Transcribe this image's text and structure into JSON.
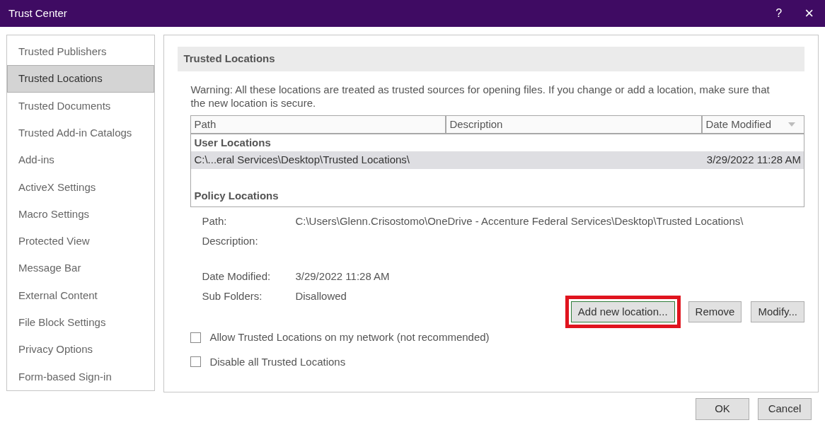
{
  "window": {
    "title": "Trust Center",
    "help": "?",
    "close": "×"
  },
  "sidebar": {
    "items": [
      {
        "label": "Trusted Publishers",
        "selected": false
      },
      {
        "label": "Trusted Locations",
        "selected": true
      },
      {
        "label": "Trusted Documents",
        "selected": false
      },
      {
        "label": "Trusted Add-in Catalogs",
        "selected": false
      },
      {
        "label": "Add-ins",
        "selected": false
      },
      {
        "label": "ActiveX Settings",
        "selected": false
      },
      {
        "label": "Macro Settings",
        "selected": false
      },
      {
        "label": "Protected View",
        "selected": false
      },
      {
        "label": "Message Bar",
        "selected": false
      },
      {
        "label": "External Content",
        "selected": false
      },
      {
        "label": "File Block Settings",
        "selected": false
      },
      {
        "label": "Privacy Options",
        "selected": false
      },
      {
        "label": "Form-based Sign-in",
        "selected": false
      }
    ]
  },
  "section_title": "Trusted Locations",
  "warning": "Warning: All these locations are treated as trusted sources for opening files.  If you change or add a location, make sure that the new location is secure.",
  "table": {
    "columns": [
      "Path",
      "Description",
      "Date Modified"
    ],
    "groups": [
      {
        "title": "User Locations",
        "rows": [
          {
            "path": "C:\\...eral Services\\Desktop\\Trusted Locations\\",
            "description": "",
            "date": "3/29/2022 11:28 AM",
            "selected": true
          }
        ]
      },
      {
        "title": "Policy Locations"
      }
    ]
  },
  "details": [
    {
      "label": "Path:",
      "value": "C:\\Users\\Glenn.Crisostomo\\OneDrive - Accenture Federal Services\\Desktop\\Trusted Locations\\"
    },
    {
      "label": "Description:"
    },
    {
      "label": "Date Modified:",
      "value": "3/29/2022 11:28 AM"
    },
    {
      "label": "Sub Folders:",
      "value": "Disallowed"
    }
  ],
  "actions": [
    {
      "label": "Add new location...",
      "highlighted": true
    },
    {
      "label": "Remove",
      "highlighted": false
    },
    {
      "label": "Modify...",
      "highlighted": false
    }
  ],
  "checkboxes": [
    {
      "label": "Allow Trusted Locations on my network (not recommended)",
      "checked": false
    },
    {
      "label": "Disable all Trusted Locations",
      "checked": false
    }
  ],
  "footer_buttons": [
    "OK",
    "Cancel"
  ]
}
